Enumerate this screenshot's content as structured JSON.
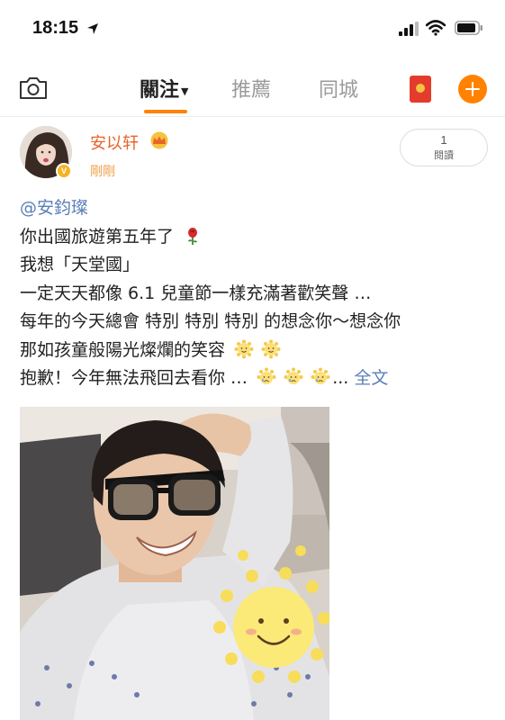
{
  "status_bar": {
    "time": "18:15"
  },
  "nav": {
    "tabs": [
      {
        "label": "關注",
        "active": true
      },
      {
        "label": "推薦",
        "active": false
      },
      {
        "label": "同城",
        "active": false
      }
    ],
    "accent_color": "#ff8200"
  },
  "post": {
    "author": "安以轩",
    "time": "剛剛",
    "read_count": "1",
    "read_label": "閱讀",
    "lines": [
      {
        "text": "@安鈞璨",
        "type": "mention"
      },
      {
        "text": "你出國旅遊第五年了",
        "suffix_icons": [
          "rose-icon"
        ]
      },
      {
        "text": "我想「天堂國」"
      },
      {
        "text": "一定天天都像 6.1 兒童節一樣充滿著歡笑聲 …"
      },
      {
        "text": "每年的今天總會 特別 特別 特別 的想念你～想念你"
      },
      {
        "text": "那如孩童般陽光燦爛的笑容",
        "suffix_icons": [
          "sun-smile-icon",
          "sun-smile-icon"
        ]
      },
      {
        "text": "抱歉！今年無法飛回去看你 …",
        "suffix_icons": [
          "sad-face-icon",
          "sad-face-icon",
          "sad-face-icon"
        ],
        "ellipsis": "...",
        "link": "全文"
      }
    ],
    "name_color": "#e8642a",
    "link_color": "#5a7fb5"
  }
}
